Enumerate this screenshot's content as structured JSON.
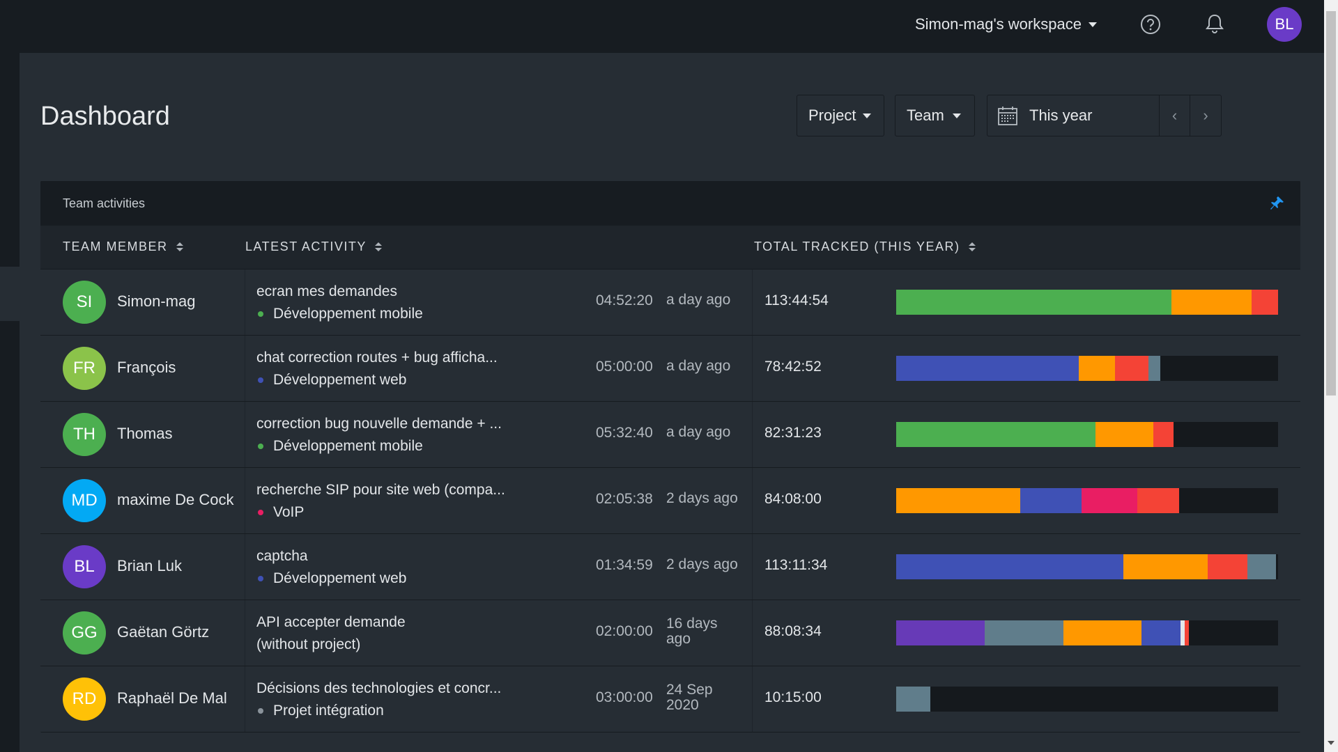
{
  "topbar": {
    "workspace": "Simon-mag's workspace",
    "help_icon": "help-circle-icon",
    "bell_icon": "bell-icon",
    "user_initials": "BL"
  },
  "page": {
    "title": "Dashboard",
    "filters": {
      "project": "Project",
      "team": "Team",
      "date_range": "This year",
      "prev": "‹",
      "next": "›"
    }
  },
  "card": {
    "title": "Team activities",
    "pin_icon": "pin-icon",
    "columns": {
      "member": "TEAM MEMBER",
      "activity": "LATEST ACTIVITY",
      "total": "TOTAL TRACKED (THIS YEAR)"
    }
  },
  "colors": {
    "green": "#4caf50",
    "orange": "#ff9800",
    "red": "#f44336",
    "indigo": "#3f51b5",
    "slate": "#607d8b",
    "pink": "#e91e63",
    "purple": "#673ab7",
    "light": "#e3e6e9"
  },
  "members": [
    {
      "initials": "SI",
      "avatar_color": "#4caf50",
      "name": "Simon-mag",
      "activity": "ecran mes demandes",
      "project": "Développement mobile",
      "project_color": "#4caf50",
      "duration": "04:52:20",
      "ago": "a day ago",
      "total": "113:44:54",
      "bar": [
        {
          "c": "#4caf50",
          "v": 0.72
        },
        {
          "c": "#ff9800",
          "v": 0.21
        },
        {
          "c": "#f44336",
          "v": 0.07
        }
      ]
    },
    {
      "initials": "FR",
      "avatar_color": "#8bc34a",
      "name": "François",
      "activity": "chat correction routes + bug afficha...",
      "project": "Développement web",
      "project_color": "#3f51b5",
      "duration": "05:00:00",
      "ago": "a day ago",
      "total": "78:42:52",
      "bar": [
        {
          "c": "#3f51b5",
          "v": 0.478
        },
        {
          "c": "#ff9800",
          "v": 0.095
        },
        {
          "c": "#f44336",
          "v": 0.088
        },
        {
          "c": "#607d8b",
          "v": 0.031
        }
      ]
    },
    {
      "initials": "TH",
      "avatar_color": "#4caf50",
      "name": "Thomas",
      "activity": "correction bug nouvelle demande + ...",
      "project": "Développement mobile",
      "project_color": "#4caf50",
      "duration": "05:32:40",
      "ago": "a day ago",
      "total": "82:31:23",
      "bar": [
        {
          "c": "#4caf50",
          "v": 0.522
        },
        {
          "c": "#ff9800",
          "v": 0.151
        },
        {
          "c": "#f44336",
          "v": 0.053
        }
      ]
    },
    {
      "initials": "MD",
      "avatar_color": "#03a9f4",
      "name": "maxime De Cock",
      "activity": "recherche SIP pour site web (compa...",
      "project": "VoIP",
      "project_color": "#e91e63",
      "duration": "02:05:38",
      "ago": "2 days ago",
      "total": "84:08:00",
      "bar": [
        {
          "c": "#ff9800",
          "v": 0.325
        },
        {
          "c": "#3f51b5",
          "v": 0.16
        },
        {
          "c": "#e91e63",
          "v": 0.146
        },
        {
          "c": "#f44336",
          "v": 0.11
        }
      ]
    },
    {
      "initials": "BL",
      "avatar_color": "#6a3bc7",
      "name": "Brian Luk",
      "activity": "captcha",
      "project": "Développement web",
      "project_color": "#3f51b5",
      "duration": "01:34:59",
      "ago": "2 days ago",
      "total": "113:11:34",
      "bar": [
        {
          "c": "#3f51b5",
          "v": 0.595
        },
        {
          "c": "#ff9800",
          "v": 0.221
        },
        {
          "c": "#f44336",
          "v": 0.104
        },
        {
          "c": "#607d8b",
          "v": 0.075
        }
      ]
    },
    {
      "initials": "GG",
      "avatar_color": "#4caf50",
      "name": "Gaëtan Görtz",
      "activity": "API accepter demande",
      "activity_line2": "(without project)",
      "project": "",
      "project_color": "",
      "duration": "02:00:00",
      "ago": "16 days ago",
      "total": "88:08:34",
      "bar": [
        {
          "c": "#673ab7",
          "v": 0.232
        },
        {
          "c": "#607d8b",
          "v": 0.206
        },
        {
          "c": "#ff9800",
          "v": 0.205
        },
        {
          "c": "#3f51b5",
          "v": 0.101
        },
        {
          "c": "#e3e6e9",
          "v": 0.012
        },
        {
          "c": "#f44336",
          "v": 0.01
        }
      ]
    },
    {
      "initials": "RD",
      "avatar_color": "#ffc107",
      "name": "Raphaël De Mal",
      "activity": "Décisions des technologies et concr...",
      "project": "Projet intégration",
      "project_color": "#8a939b",
      "duration": "03:00:00",
      "ago": "24 Sep 2020",
      "total": "10:15:00",
      "bar": [
        {
          "c": "#607d8b",
          "v": 0.09
        }
      ]
    }
  ]
}
